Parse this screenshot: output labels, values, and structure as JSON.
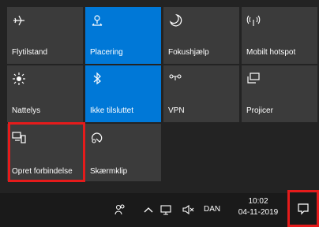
{
  "tiles": [
    {
      "label": "Flytilstand",
      "icon": "airplane-icon",
      "active": false
    },
    {
      "label": "Placering",
      "icon": "location-icon",
      "active": true
    },
    {
      "label": "Fokushjælp",
      "icon": "moon-icon",
      "active": false
    },
    {
      "label": "Mobilt hotspot",
      "icon": "hotspot-icon",
      "active": false
    },
    {
      "label": "Nattelys",
      "icon": "brightness-icon",
      "active": false
    },
    {
      "label": "Ikke tilsluttet",
      "icon": "bluetooth-icon",
      "active": true
    },
    {
      "label": "VPN",
      "icon": "vpn-icon",
      "active": false
    },
    {
      "label": "Projicer",
      "icon": "project-icon",
      "active": false
    },
    {
      "label": "Opret forbindelse",
      "icon": "connect-icon",
      "active": false
    },
    {
      "label": "Skærmklip",
      "icon": "screen-snip-icon",
      "active": false
    }
  ],
  "taskbar": {
    "language": "DAN",
    "time": "10:02",
    "date": "04-11-2019"
  },
  "colors": {
    "active_tile": "#0078d7",
    "inactive_tile": "#3b3b3b",
    "highlight": "#e51b1b"
  }
}
